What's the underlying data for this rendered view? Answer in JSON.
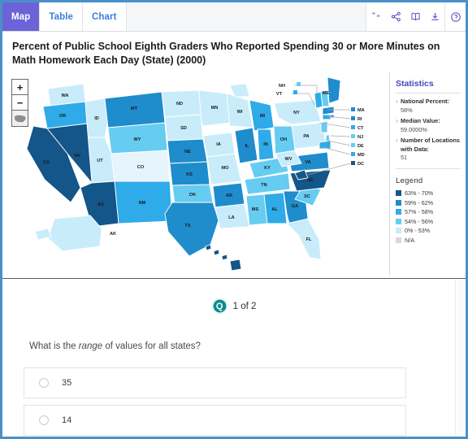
{
  "tabs": [
    {
      "label": "Map",
      "active": true
    },
    {
      "label": "Table",
      "active": false
    },
    {
      "label": "Chart",
      "active": false
    }
  ],
  "toolbar": {
    "icons": [
      {
        "name": "quote-icon",
        "title": "Cite"
      },
      {
        "name": "share-icon",
        "title": "Share"
      },
      {
        "name": "book-icon",
        "title": "Definitions"
      },
      {
        "name": "download-icon",
        "title": "Download"
      },
      {
        "name": "help-icon",
        "title": "Help"
      }
    ]
  },
  "chart_title": "Percent of Public School Eighth Graders Who Reported Spending 30 or More Minutes on Math Homework Each Day (State) (2000)",
  "map_controls": {
    "zoom_in": "+",
    "zoom_out": "−",
    "reset": "reset-map"
  },
  "statistics": {
    "heading": "Statistics",
    "items": [
      {
        "label": "National Percent:",
        "value": "58%"
      },
      {
        "label": "Median Value:",
        "value": "59.0000%"
      },
      {
        "label": "Number of Locations with Data:",
        "value": "51"
      }
    ]
  },
  "legend": {
    "heading": "Legend",
    "items": [
      {
        "label": "63% - 70%",
        "color": "#14558a"
      },
      {
        "label": "59% - 62%",
        "color": "#1f8ccc"
      },
      {
        "label": "57% - 58%",
        "color": "#2eabe8"
      },
      {
        "label": "54% - 56%",
        "color": "#66ccf2"
      },
      {
        "label": "0% - 53%",
        "color": "#c9ecfa"
      },
      {
        "label": "N/A",
        "color": "#d9d9d9"
      }
    ]
  },
  "question": {
    "counter": "1 of 2",
    "badge_letter": "Q",
    "text_before": "What is the ",
    "text_emphasis": "range",
    "text_after": " of values for all states?",
    "options": [
      {
        "label": "35",
        "selected": false
      },
      {
        "label": "14",
        "selected": false
      }
    ]
  },
  "chart_data": {
    "type": "map",
    "title": "Percent of Public School Eighth Graders Who Reported Spending 30 or More Minutes on Math Homework Each Day (State) (2000)",
    "unit": "percent",
    "national_percent": 58,
    "median_value": 59.0,
    "locations_with_data": 51,
    "bins": [
      {
        "label": "63% - 70%",
        "color": "#14558a",
        "min": 63,
        "max": 70
      },
      {
        "label": "59% - 62%",
        "color": "#1f8ccc",
        "min": 59,
        "max": 62
      },
      {
        "label": "57% - 58%",
        "color": "#2eabe8",
        "min": 57,
        "max": 58
      },
      {
        "label": "54% - 56%",
        "color": "#66ccf2",
        "min": 54,
        "max": 56
      },
      {
        "label": "0% - 53%",
        "color": "#c9ecfa",
        "min": 0,
        "max": 53
      },
      {
        "label": "N/A",
        "color": "#d9d9d9",
        "min": null,
        "max": null
      }
    ],
    "states": [
      {
        "code": "WA",
        "bin": "0% - 53%"
      },
      {
        "code": "OR",
        "bin": "57% - 58%"
      },
      {
        "code": "CA",
        "bin": "63% - 70%"
      },
      {
        "code": "NV",
        "bin": "63% - 70%"
      },
      {
        "code": "ID",
        "bin": "0% - 53%"
      },
      {
        "code": "MT",
        "bin": "59% - 62%"
      },
      {
        "code": "WY",
        "bin": "54% - 56%"
      },
      {
        "code": "UT",
        "bin": "0% - 53%"
      },
      {
        "code": "AZ",
        "bin": "63% - 70%"
      },
      {
        "code": "CO",
        "bin": "0% - 53%"
      },
      {
        "code": "NM",
        "bin": "57% - 58%"
      },
      {
        "code": "ND",
        "bin": "0% - 53%"
      },
      {
        "code": "SD",
        "bin": "0% - 53%"
      },
      {
        "code": "NE",
        "bin": "59% - 62%"
      },
      {
        "code": "KS",
        "bin": "59% - 62%"
      },
      {
        "code": "OK",
        "bin": "54% - 56%"
      },
      {
        "code": "TX",
        "bin": "59% - 62%"
      },
      {
        "code": "MN",
        "bin": "0% - 53%"
      },
      {
        "code": "IA",
        "bin": "0% - 53%"
      },
      {
        "code": "MO",
        "bin": "0% - 53%"
      },
      {
        "code": "AR",
        "bin": "59% - 62%"
      },
      {
        "code": "LA",
        "bin": "0% - 53%"
      },
      {
        "code": "WI",
        "bin": "0% - 53%"
      },
      {
        "code": "IL",
        "bin": "59% - 62%"
      },
      {
        "code": "MI",
        "bin": "57% - 58%"
      },
      {
        "code": "IN",
        "bin": "57% - 58%"
      },
      {
        "code": "OH",
        "bin": "54% - 56%"
      },
      {
        "code": "KY",
        "bin": "54% - 56%"
      },
      {
        "code": "TN",
        "bin": "54% - 56%"
      },
      {
        "code": "MS",
        "bin": "54% - 56%"
      },
      {
        "code": "AL",
        "bin": "57% - 58%"
      },
      {
        "code": "GA",
        "bin": "59% - 62%"
      },
      {
        "code": "FL",
        "bin": "0% - 53%"
      },
      {
        "code": "SC",
        "bin": "54% - 56%"
      },
      {
        "code": "NC",
        "bin": "63% - 70%"
      },
      {
        "code": "VA",
        "bin": "59% - 62%"
      },
      {
        "code": "WV",
        "bin": "0% - 53%"
      },
      {
        "code": "PA",
        "bin": "0% - 53%"
      },
      {
        "code": "NY",
        "bin": "0% - 53%"
      },
      {
        "code": "VT",
        "bin": "57% - 58%"
      },
      {
        "code": "NH",
        "bin": "54% - 56%"
      },
      {
        "code": "ME",
        "bin": "59% - 62%"
      },
      {
        "code": "MA",
        "bin": "59% - 62%"
      },
      {
        "code": "RI",
        "bin": "59% - 62%"
      },
      {
        "code": "CT",
        "bin": "57% - 58%"
      },
      {
        "code": "NJ",
        "bin": "54% - 56%"
      },
      {
        "code": "DE",
        "bin": "54% - 56%"
      },
      {
        "code": "MD",
        "bin": "57% - 58%"
      },
      {
        "code": "DC",
        "bin": "63% - 70%"
      },
      {
        "code": "AK",
        "bin": "0% - 53%"
      },
      {
        "code": "HI",
        "bin": "63% - 70%"
      }
    ],
    "callout_states": [
      "NH",
      "VT",
      "MA",
      "RI",
      "CT",
      "NJ",
      "DE",
      "MD",
      "DC"
    ]
  }
}
